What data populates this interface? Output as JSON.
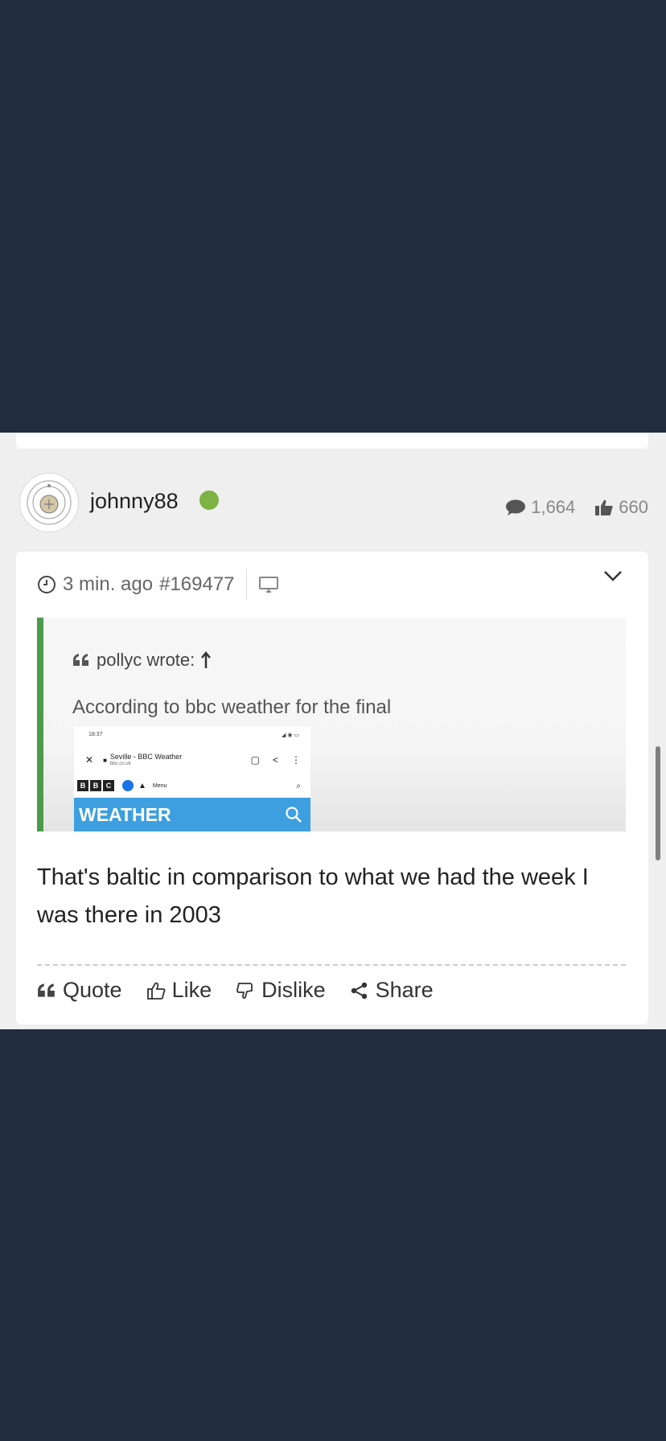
{
  "user": {
    "username": "johnny88",
    "comments_count": "1,664",
    "likes_count": "660",
    "online_color": "#7cb342"
  },
  "post": {
    "time_ago": "3 min. ago",
    "post_id": "#169477",
    "quote": {
      "author_line": "pollyc wrote:",
      "text": "According to bbc weather for the final",
      "image": {
        "status_time": "18:37",
        "page_title": "Seville - BBC Weather",
        "page_url": "bbc.co.uk",
        "menu_label": "Menu",
        "banner": "WEATHER",
        "bbc_letters": [
          "B",
          "B",
          "C"
        ]
      }
    },
    "body": "That's baltic in comparison to what we had the week I was there in 2003",
    "actions": {
      "quote": "Quote",
      "like": "Like",
      "dislike": "Dislike",
      "share": "Share"
    },
    "quote_bar_color": "#4e9a4c"
  }
}
